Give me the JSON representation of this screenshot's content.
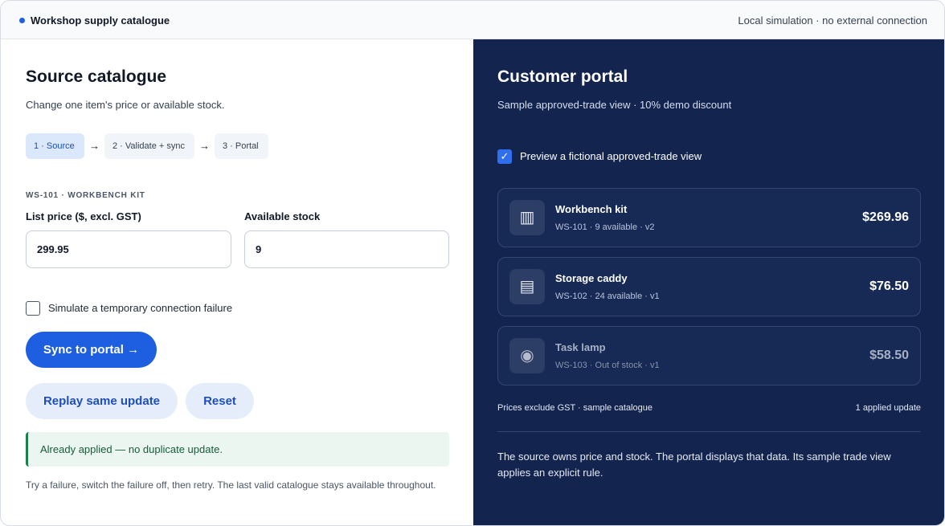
{
  "header": {
    "title": "Workshop supply catalogue",
    "status": "Local simulation · no external connection",
    "accent": "#1d5fe0"
  },
  "source": {
    "title": "Source catalogue",
    "subtitle": "Change one item's price or available stock.",
    "steps": [
      {
        "label": "1 · Source",
        "active": true
      },
      {
        "label": "2 · Validate + sync",
        "active": false
      },
      {
        "label": "3 · Portal",
        "active": false
      }
    ],
    "step_arrow": "→",
    "item_code": "WS-101 · WORKBENCH KIT",
    "price_label": "List price ($, excl. GST)",
    "price_value": "299.95",
    "stock_label": "Available stock",
    "stock_value": "9",
    "failure_label": "Simulate a temporary connection failure",
    "failure_checked": false,
    "sync_button": "Sync to portal →",
    "replay_button": "Replay same update",
    "reset_button": "Reset",
    "notice": "Already applied — no duplicate update.",
    "hint": "Try a failure, switch the failure off, then retry. The last valid catalogue stays available throughout."
  },
  "portal": {
    "title": "Customer portal",
    "subtitle": "Sample approved-trade view · 10% demo discount",
    "preview_label": "Preview a fictional approved-trade view",
    "preview_checked": true,
    "products": [
      {
        "name": "Workbench kit",
        "meta": "WS-101 · 9 available · v2",
        "price": "$269.96",
        "icon": "barcode-icon",
        "glyph": "▥",
        "in_stock": true
      },
      {
        "name": "Storage caddy",
        "meta": "WS-102 · 24 available · v1",
        "price": "$76.50",
        "icon": "storage-icon",
        "glyph": "▤",
        "in_stock": true
      },
      {
        "name": "Task lamp",
        "meta": "WS-103 · Out of stock · v1",
        "price": "$58.50",
        "icon": "lamp-icon",
        "glyph": "◉",
        "in_stock": false
      }
    ],
    "footer_left": "Prices exclude GST · sample catalogue",
    "footer_right": "1 applied update",
    "note": "The source owns price and stock. The portal displays that data. Its sample trade view applies an explicit rule."
  }
}
